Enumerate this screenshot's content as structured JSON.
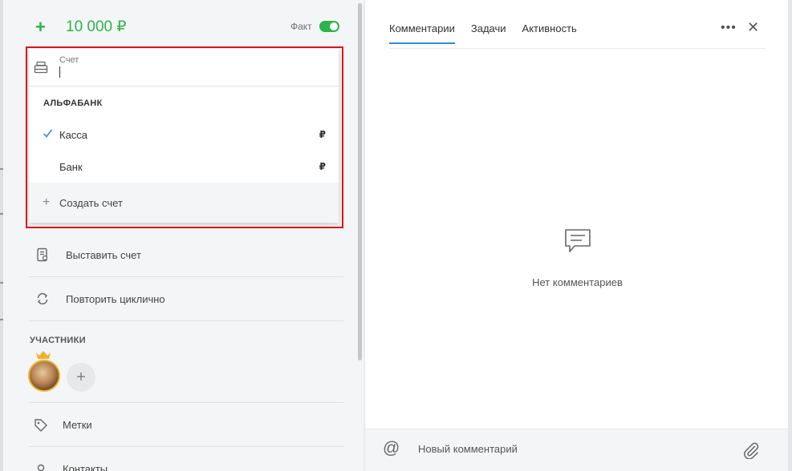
{
  "header": {
    "plus_symbol": "+",
    "amount": "10 000 ₽",
    "fact_label": "Факт",
    "fact_enabled": true
  },
  "account_dropdown": {
    "field_label": "Счет",
    "field_value": "",
    "group_name": "АЛЬФАБАНК",
    "items": [
      {
        "label": "Касса",
        "currency": "₽",
        "selected": true
      },
      {
        "label": "Банк",
        "currency": "₽",
        "selected": false
      }
    ],
    "create_label": "Создать счет"
  },
  "menu": {
    "invoice_label": "Выставить счет",
    "repeat_label": "Повторить циклично",
    "participants_title": "УЧАСТНИКИ",
    "tags_label": "Метки",
    "contacts_label": "Контакты"
  },
  "right_panel": {
    "tabs": [
      {
        "label": "Комментарии",
        "active": true
      },
      {
        "label": "Задачи",
        "active": false
      },
      {
        "label": "Активность",
        "active": false
      }
    ],
    "more_symbol": "•••",
    "close_symbol": "✕",
    "empty_text": "Нет комментариев",
    "comment_placeholder": "Новый комментарий",
    "mention_symbol": "@"
  },
  "colors": {
    "accent_green": "#2db34a",
    "tab_active": "#2e8dd6",
    "highlight_red": "#e3141b",
    "check_blue": "#2e8dd6"
  },
  "icons": [
    "plus-icon",
    "toggle-switch",
    "cash-register-icon",
    "check-icon",
    "invoice-icon",
    "repeat-icon",
    "crown-icon",
    "tag-icon",
    "contacts-icon",
    "more-icon",
    "close-icon",
    "comment-icon",
    "at-icon",
    "paperclip-icon"
  ]
}
